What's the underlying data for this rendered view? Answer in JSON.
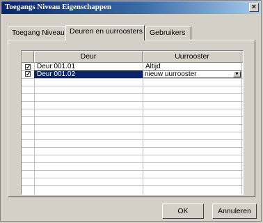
{
  "window": {
    "title": "Toegangs Niveau Eigenschappen",
    "close_label": "×"
  },
  "tabs": [
    {
      "label": "Toegang Niveau"
    },
    {
      "label": "Deuren en uurroosters"
    },
    {
      "label": "Gebruikers"
    }
  ],
  "grid": {
    "columns": [
      "Deur",
      "Uurrooster"
    ],
    "rows": [
      {
        "checked": true,
        "deur": "Deur 001.01",
        "uurrooster": "Altijd",
        "selected": false
      },
      {
        "checked": true,
        "deur": "Deur 001.02",
        "uurrooster": "nieuw uurrooster",
        "selected": true
      }
    ]
  },
  "buttons": {
    "ok": "OK",
    "cancel": "Annuleren"
  }
}
